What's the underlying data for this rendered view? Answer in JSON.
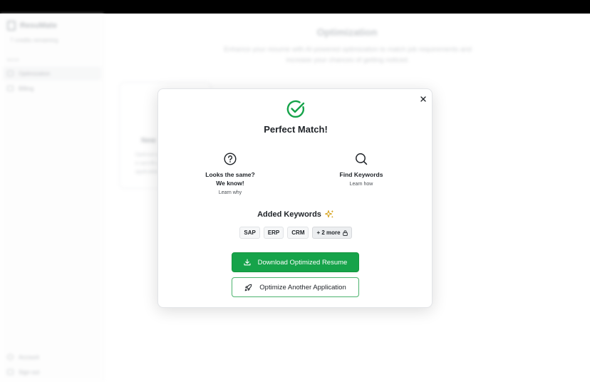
{
  "app": {
    "brand_name": "ResuMate",
    "credits": "7 credits remaining",
    "section_label": "MAIN",
    "nav": [
      {
        "label": "Optimization"
      },
      {
        "label": "Billing"
      }
    ],
    "footer_nav": [
      {
        "label": "Account"
      },
      {
        "label": "Sign out"
      }
    ],
    "page_title": "Optimization",
    "page_subtitle": "Enhance your resume with AI-powered optimization to match job requirements and increase your chances of getting noticed.",
    "card": {
      "title": "New",
      "desc": "Optimize a resume for a specific job application"
    }
  },
  "modal": {
    "title": "Perfect Match!",
    "left": {
      "heading_line1": "Looks the same?",
      "heading_line2": "We know!",
      "link": "Learn why",
      "icon": "question-circle-icon"
    },
    "right": {
      "heading": "Find Keywords",
      "link": "Learn how",
      "icon": "search-icon"
    },
    "keywords_title": "Added Keywords",
    "keywords": [
      "SAP",
      "ERP",
      "CRM"
    ],
    "more_label": "+ 2 more",
    "primary_button": "Download Optimized Resume",
    "secondary_button": "Optimize Another Application"
  },
  "colors": {
    "accent_green": "#16a34a",
    "sparkle_gold": "#d4a017"
  }
}
